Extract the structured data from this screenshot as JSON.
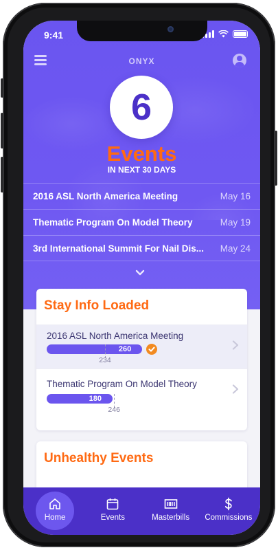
{
  "status": {
    "time": "9:41"
  },
  "header": {
    "brand": "ONYX"
  },
  "summary": {
    "count": "6",
    "label": "Events",
    "sublabel": "IN NEXT 30 DAYS"
  },
  "upcoming": [
    {
      "name": "2016 ASL North America Meeting",
      "date": "May 16"
    },
    {
      "name": "Thematic Program On Model Theory",
      "date": "May 19"
    },
    {
      "name": "3rd International Summit For Nail Dis...",
      "date": "May 24"
    }
  ],
  "stay_card": {
    "title": "Stay Info Loaded",
    "items": [
      {
        "name": "2016 ASL North America Meeting",
        "value": "260",
        "target": "234",
        "fill": 0.58,
        "target_pos": 0.355,
        "met": true
      },
      {
        "name": "Thematic Program On Model Theory",
        "value": "180",
        "target": "246",
        "fill": 0.4,
        "target_pos": 0.41,
        "met": false
      }
    ]
  },
  "unhealthy_card": {
    "title": "Unhealthy Events"
  },
  "tabs": [
    {
      "label": "Home",
      "icon": "home-icon",
      "active": true
    },
    {
      "label": "Events",
      "icon": "calendar-icon",
      "active": false
    },
    {
      "label": "Masterbills",
      "icon": "barcode-icon",
      "active": false
    },
    {
      "label": "Commissions",
      "icon": "dollar-icon",
      "active": false
    }
  ],
  "colors": {
    "primary": "#6b55ee",
    "accent": "#ff6a13",
    "tabbar": "#4b30c8",
    "check": "#f28a21"
  }
}
